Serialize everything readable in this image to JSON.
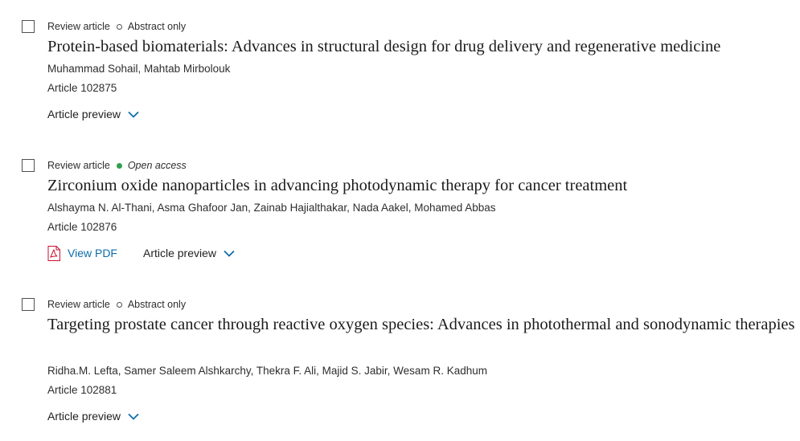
{
  "articles": [
    {
      "type": "Review article",
      "access": "Abstract only",
      "access_kind": "abstract",
      "title": "Protein-based biomaterials: Advances in structural design for drug delivery and regenerative medicine",
      "authors": "Muhammad Sohail, Mahtab Mirbolouk",
      "article_number": "Article 102875",
      "preview_label": "Article preview",
      "pdf_label": ""
    },
    {
      "type": "Review article",
      "access": "Open access",
      "access_kind": "open",
      "title": "Zirconium oxide nanoparticles in advancing photodynamic therapy for cancer treatment",
      "authors": "Alshayma N. Al-Thani, Asma Ghafoor Jan, Zainab Hajialthakar, Nada Aakel, Mohamed Abbas",
      "article_number": "Article 102876",
      "preview_label": "Article preview",
      "pdf_label": "View PDF"
    },
    {
      "type": "Review article",
      "access": "Abstract only",
      "access_kind": "abstract",
      "title": "Targeting prostate cancer through reactive oxygen species: Advances in photothermal and sonodynamic therapies",
      "authors": "Ridha.M. Lefta, Samer Saleem Alshkarchy, Thekra F. Ali, Majid S. Jabir, Wesam R. Kadhum",
      "article_number": "Article 102881",
      "preview_label": "Article preview",
      "pdf_label": ""
    }
  ],
  "colors": {
    "link": "#0c6dab",
    "open_access_dot": "#2ea04f",
    "text": "#1f1f1f",
    "pdf_icon": "#c8102e"
  },
  "icons": {
    "checkbox": "checkbox-icon",
    "abstract_dot": "hollow-circle-icon",
    "open_dot": "green-dot-icon",
    "pdf": "pdf-file-icon",
    "chevron": "chevron-down-icon"
  }
}
